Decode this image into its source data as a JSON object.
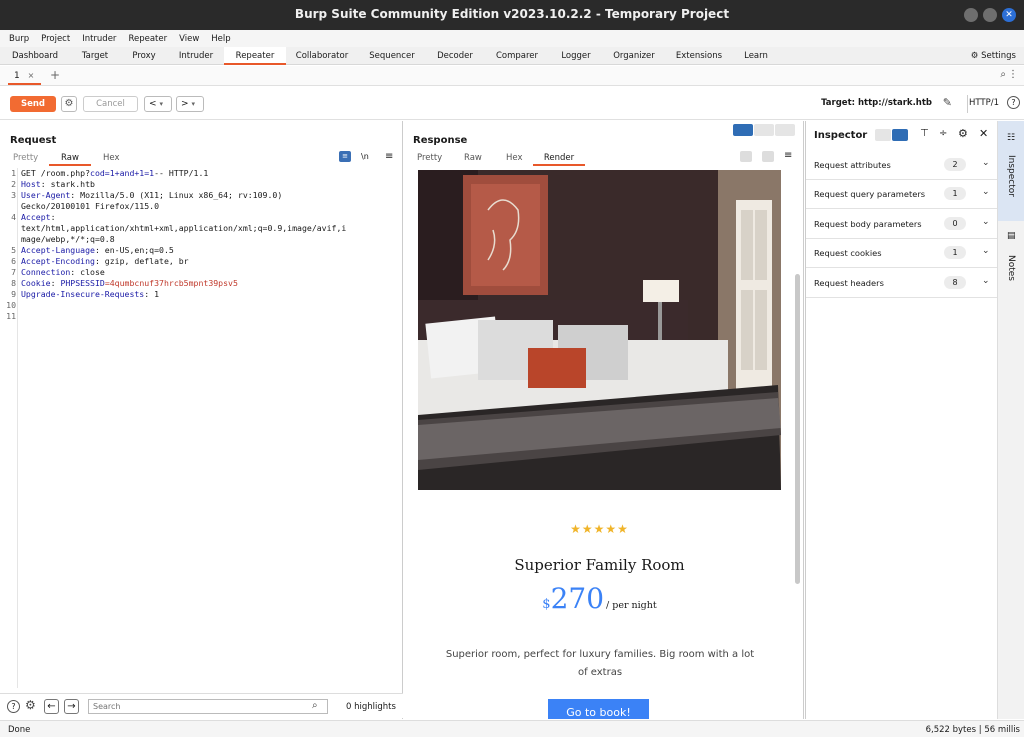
{
  "window": {
    "title": "Burp Suite Community Edition v2023.10.2.2 - Temporary Project"
  },
  "menu": [
    "Burp",
    "Project",
    "Intruder",
    "Repeater",
    "View",
    "Help"
  ],
  "main_tabs": [
    "Dashboard",
    "Target",
    "Proxy",
    "Intruder",
    "Repeater",
    "Collaborator",
    "Sequencer",
    "Decoder",
    "Comparer",
    "Logger",
    "Organizer",
    "Extensions",
    "Learn"
  ],
  "settings_label": "Settings",
  "repeater_tab": {
    "label": "1",
    "close": "×",
    "add": "+"
  },
  "toolbar": {
    "send": "Send",
    "cancel": "Cancel",
    "prev": "<",
    "next": ">",
    "target": "Target: http://stark.htb",
    "protocol": "HTTP/1"
  },
  "request": {
    "title": "Request",
    "tabs": [
      "Pretty",
      "Raw",
      "Hex"
    ],
    "ln_label": "\\n",
    "lines": [
      {
        "n": "1",
        "parts": [
          {
            "t": "GET /room.php?",
            "c": "v"
          },
          {
            "t": "cod=1+and+1=1",
            "c": "k"
          },
          {
            "t": "-- HTTP/1.1",
            "c": "v"
          }
        ]
      },
      {
        "n": "2",
        "parts": [
          {
            "t": "Host",
            "c": "k"
          },
          {
            "t": ": stark.htb",
            "c": "v"
          }
        ]
      },
      {
        "n": "3",
        "parts": [
          {
            "t": "User-Agent",
            "c": "k"
          },
          {
            "t": ": Mozilla/5.0 (X11; Linux x86_64; rv:109.0)",
            "c": "v"
          }
        ]
      },
      {
        "n": "",
        "parts": [
          {
            "t": "Gecko/20100101 Firefox/115.0",
            "c": "v"
          }
        ]
      },
      {
        "n": "4",
        "parts": [
          {
            "t": "Accept",
            "c": "k"
          },
          {
            "t": ":",
            "c": "v"
          }
        ]
      },
      {
        "n": "",
        "parts": [
          {
            "t": "text/html,application/xhtml+xml,application/xml;q=0.9,image/avif,i",
            "c": "v"
          }
        ]
      },
      {
        "n": "",
        "parts": [
          {
            "t": "mage/webp,*/*;q=0.8",
            "c": "v"
          }
        ]
      },
      {
        "n": "5",
        "parts": [
          {
            "t": "Accept-Language",
            "c": "k"
          },
          {
            "t": ": en-US,en;q=0.5",
            "c": "v"
          }
        ]
      },
      {
        "n": "6",
        "parts": [
          {
            "t": "Accept-Encoding",
            "c": "k"
          },
          {
            "t": ": gzip, deflate, br",
            "c": "v"
          }
        ]
      },
      {
        "n": "7",
        "parts": [
          {
            "t": "Connection",
            "c": "k"
          },
          {
            "t": ": close",
            "c": "v"
          }
        ]
      },
      {
        "n": "8",
        "parts": [
          {
            "t": "Cookie",
            "c": "k"
          },
          {
            "t": ": ",
            "c": "v"
          },
          {
            "t": "PHPSESSID",
            "c": "k"
          },
          {
            "t": "=4qumbcnuf37hrcb5mpnt39psv5",
            "c": "red"
          }
        ]
      },
      {
        "n": "9",
        "parts": [
          {
            "t": "Upgrade-Insecure-Requests",
            "c": "k"
          },
          {
            "t": ": 1",
            "c": "v"
          }
        ]
      },
      {
        "n": "10",
        "parts": []
      },
      {
        "n": "11",
        "parts": []
      }
    ],
    "search_placeholder": "Search",
    "highlights": "0 highlights"
  },
  "response": {
    "title": "Response",
    "tabs": [
      "Pretty",
      "Raw",
      "Hex",
      "Render"
    ],
    "render": {
      "stars": "★★★★★",
      "room_title": "Superior Family Room",
      "currency": "$",
      "price": "270",
      "per": "/ per night",
      "description": "Superior room, perfect for luxury families. Big room with a lot of extras",
      "cta": "Go to book!"
    }
  },
  "inspector": {
    "title": "Inspector",
    "rows": [
      {
        "label": "Request attributes",
        "count": "2"
      },
      {
        "label": "Request query parameters",
        "count": "1"
      },
      {
        "label": "Request body parameters",
        "count": "0"
      },
      {
        "label": "Request cookies",
        "count": "1"
      },
      {
        "label": "Request headers",
        "count": "8"
      }
    ]
  },
  "side_tabs": [
    "Inspector",
    "Notes"
  ],
  "status": {
    "left": "Done",
    "right": "6,522 bytes | 56 millis"
  },
  "colors": {
    "accent": "#e8582a",
    "send": "#f26b32",
    "blue_key": "#1a1aa6",
    "cookie_value": "#c0392b",
    "book_button": "#3b82f6"
  }
}
